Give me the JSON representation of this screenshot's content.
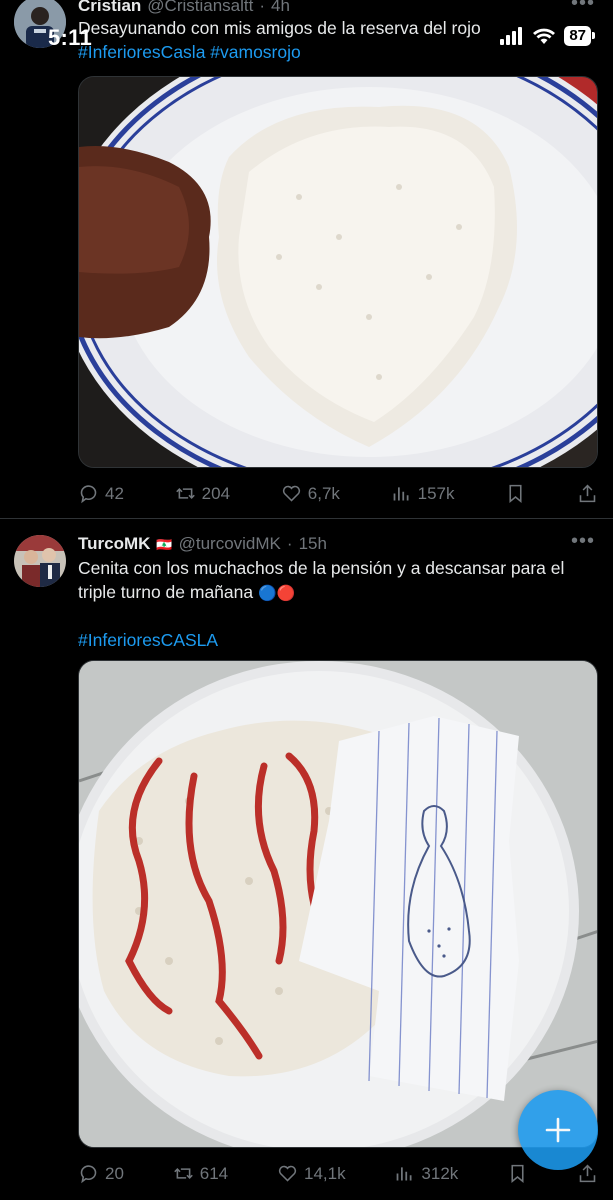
{
  "status_bar": {
    "time": "5:11",
    "battery": "87"
  },
  "tweets": [
    {
      "name": "Cristian",
      "handle": "@Cristiansaltt",
      "time": "4h",
      "text": "Desayunando con mis amigos de la reserva del rojo",
      "hashtags": "#InferioresCasla #vamosrojo",
      "replies": "42",
      "retweets": "204",
      "likes": "6,7k",
      "views": "157k"
    },
    {
      "name": "TurcoMK",
      "flag": "🇱🇧",
      "handle": "@turcovidMK",
      "time": "15h",
      "text": "Cenita con los muchachos de la pensión y a descansar para el triple turno de mañana",
      "emoji": "🔵🔴",
      "hashtags": "#InferioresCASLA",
      "replies": "20",
      "retweets": "614",
      "likes": "14,1k",
      "views": "312k"
    }
  ],
  "icons": {
    "reply": "reply-icon",
    "retweet": "retweet-icon",
    "like": "like-icon",
    "views": "views-icon",
    "bookmark": "bookmark-icon",
    "share": "share-icon",
    "compose": "compose-plus-icon"
  },
  "colors": {
    "accent": "#1d9bf0",
    "background": "#000000",
    "muted": "#71767b"
  }
}
